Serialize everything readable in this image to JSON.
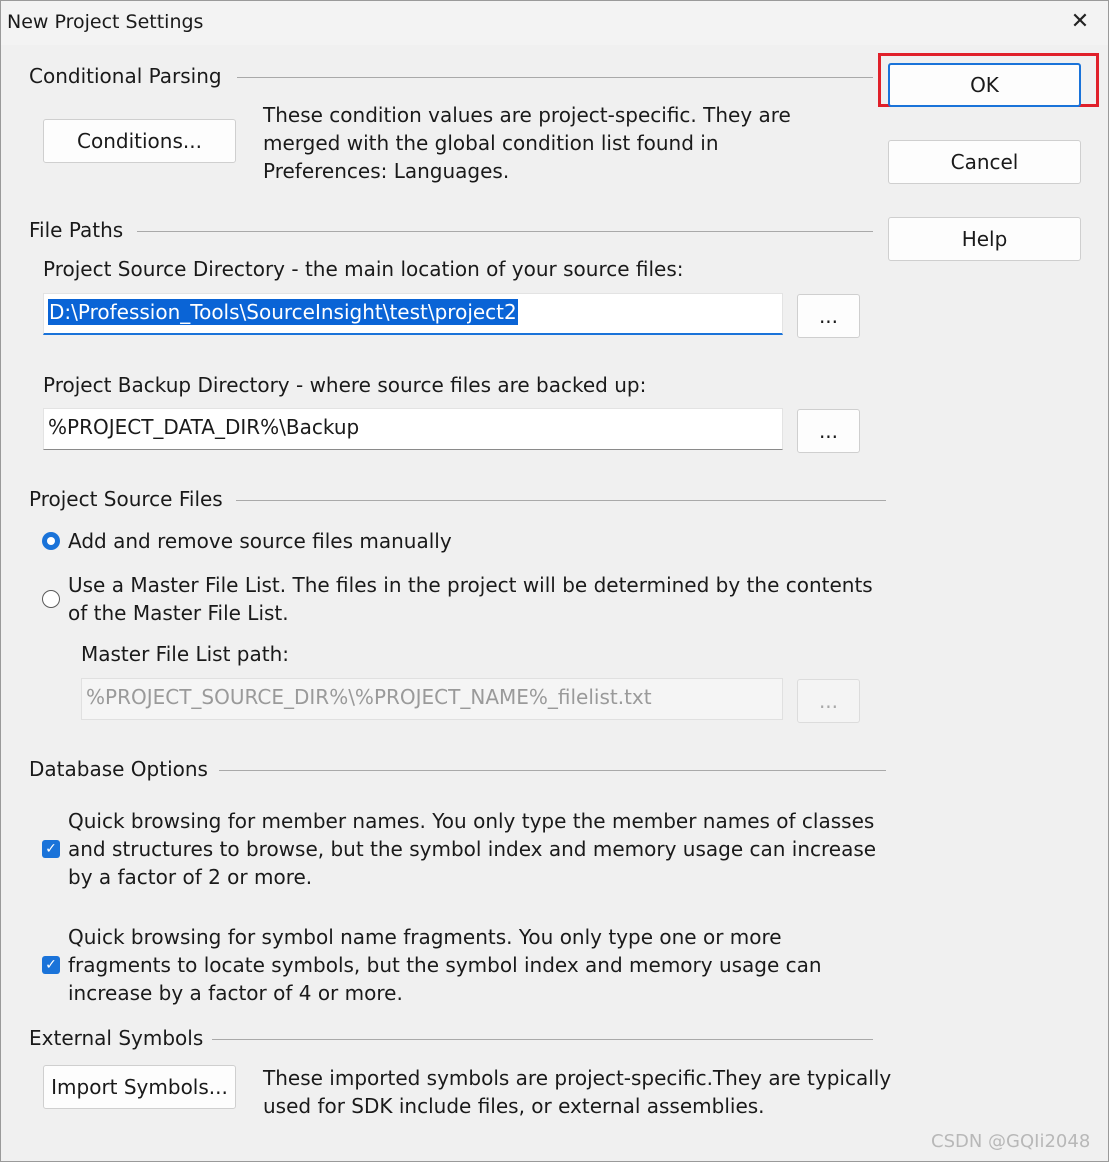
{
  "window": {
    "title": "New Project Settings",
    "close_glyph": "✕"
  },
  "actions": {
    "ok": "OK",
    "cancel": "Cancel",
    "help": "Help"
  },
  "conditional_parsing": {
    "heading": "Conditional Parsing",
    "button": "Conditions...",
    "description_lines": [
      "These condition values are project-specific.  They are",
      "merged with the global condition list found in",
      "Preferences: Languages."
    ]
  },
  "file_paths": {
    "heading": "File Paths",
    "source_dir_label": "Project Source Directory - the main location of your source files:",
    "source_dir_value": "D:\\Profession_Tools\\SourceInsight\\test\\project2",
    "backup_dir_label": "Project Backup Directory - where source files are backed up:",
    "backup_dir_value": "%PROJECT_DATA_DIR%\\Backup",
    "browse_label": "..."
  },
  "project_source_files": {
    "heading": "Project Source Files",
    "option_manual": "Add and remove source files manually",
    "option_master_lines": [
      "Use a Master File List. The files in the project will be determined by the contents",
      "of the Master File List."
    ],
    "master_path_label": "Master File List path:",
    "master_path_value": "%PROJECT_SOURCE_DIR%\\%PROJECT_NAME%_filelist.txt",
    "browse_label": "..."
  },
  "database_options": {
    "heading": "Database Options",
    "member_names_lines": [
      "Quick browsing for member names.  You only type the member names of classes",
      "and structures to browse, but the symbol index and memory usage can increase",
      "by a factor of 2 or more."
    ],
    "fragments_lines": [
      "Quick browsing for symbol name fragments.  You only type one or more",
      "fragments to locate symbols, but the symbol index and memory usage can",
      "increase by a factor of 4 or more."
    ],
    "check_glyph": "✓"
  },
  "external_symbols": {
    "heading": "External Symbols",
    "button": "Import Symbols...",
    "description_lines": [
      "These imported symbols are project-specific.They are typically",
      "used for SDK include files, or external assemblies."
    ]
  },
  "watermark": "CSDN @GQIi2048",
  "colors": {
    "accent": "#1a73d9",
    "selection": "#0a64d6",
    "highlight_box": "#e0202a",
    "background": "#f0f0f0"
  }
}
